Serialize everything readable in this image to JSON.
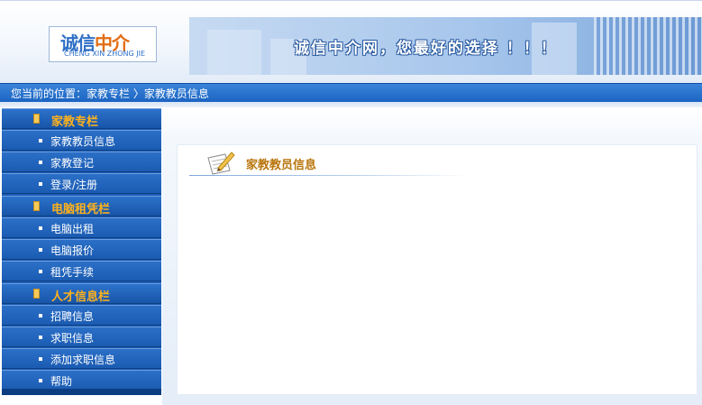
{
  "logo": {
    "c1": "诚",
    "c2": "信",
    "c3": "中",
    "c4": "介",
    "subtitle": "CHENG XIN ZHONG JIE"
  },
  "banner": {
    "slogan": "诚信中介网，您最好的选择 ！！！"
  },
  "breadcrumb": {
    "text": "您当前的位置：家教专栏 〉家教教员信息"
  },
  "sidebar": {
    "items": [
      {
        "type": "head",
        "label": "家教专栏",
        "icon": "book-icon"
      },
      {
        "type": "sub",
        "label": "家教教员信息"
      },
      {
        "type": "sub",
        "label": "家教登记"
      },
      {
        "type": "sub",
        "label": "登录/注册"
      },
      {
        "type": "head",
        "label": "电脑租凭栏",
        "icon": "book-icon"
      },
      {
        "type": "sub",
        "label": "电脑出租"
      },
      {
        "type": "sub",
        "label": "电脑报价"
      },
      {
        "type": "sub",
        "label": "租凭手续"
      },
      {
        "type": "head",
        "label": "人才信息栏",
        "icon": "book-icon"
      },
      {
        "type": "sub",
        "label": "招聘信息"
      },
      {
        "type": "sub",
        "label": "求职信息"
      },
      {
        "type": "sub",
        "label": "添加求职信息"
      },
      {
        "type": "sub",
        "label": "帮助"
      }
    ]
  },
  "main": {
    "title": "家教教员信息",
    "icon": "notepad-pencil-icon"
  },
  "colors": {
    "accent_blue": "#1d5db4",
    "head_label": "#ffb21c",
    "title": "#b8750d"
  }
}
